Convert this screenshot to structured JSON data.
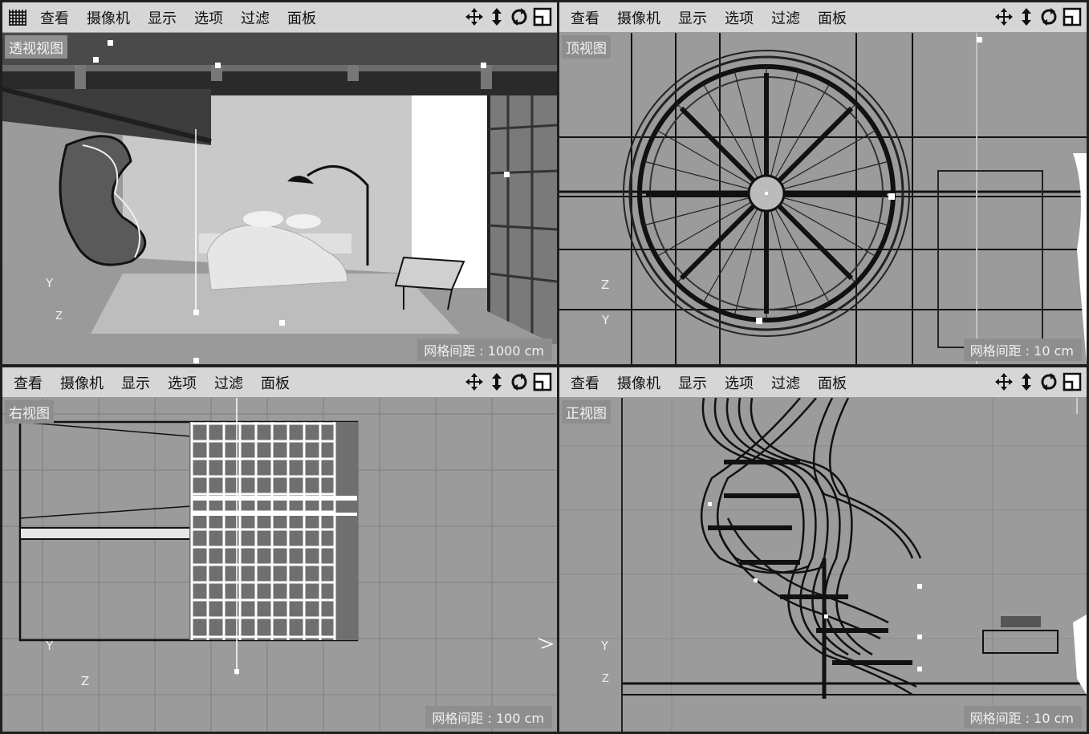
{
  "menu": {
    "view": "查看",
    "camera": "摄像机",
    "display": "显示",
    "options": "选项",
    "filter": "过滤",
    "panel": "面板"
  },
  "viewports": {
    "perspective": {
      "label": "透视视图",
      "grid_spacing": "网格间距 : 1000 cm",
      "axis_up": "Y",
      "axis_depth": "Z"
    },
    "top": {
      "label": "顶视图",
      "grid_spacing": "网格间距 : 10 cm",
      "axis_up": "Z",
      "axis_depth": "Y"
    },
    "right": {
      "label": "右视图",
      "grid_spacing": "网格间距 : 100 cm",
      "axis_up": "Y",
      "axis_depth": "Z"
    },
    "front": {
      "label": "正视图",
      "grid_spacing": "网格间距 : 10 cm",
      "axis_up": "Y",
      "axis_depth": "Z"
    }
  },
  "icons": [
    "grid-layout-icon",
    "move-view-icon",
    "zoom-view-icon",
    "rotate-view-icon",
    "maximize-view-icon"
  ],
  "colors": {
    "viewport_bg": "#9b9b9b",
    "menubar_bg": "#d6d6d6",
    "label_bg": "#8e8e8e",
    "frame": "#1f1f1f"
  }
}
